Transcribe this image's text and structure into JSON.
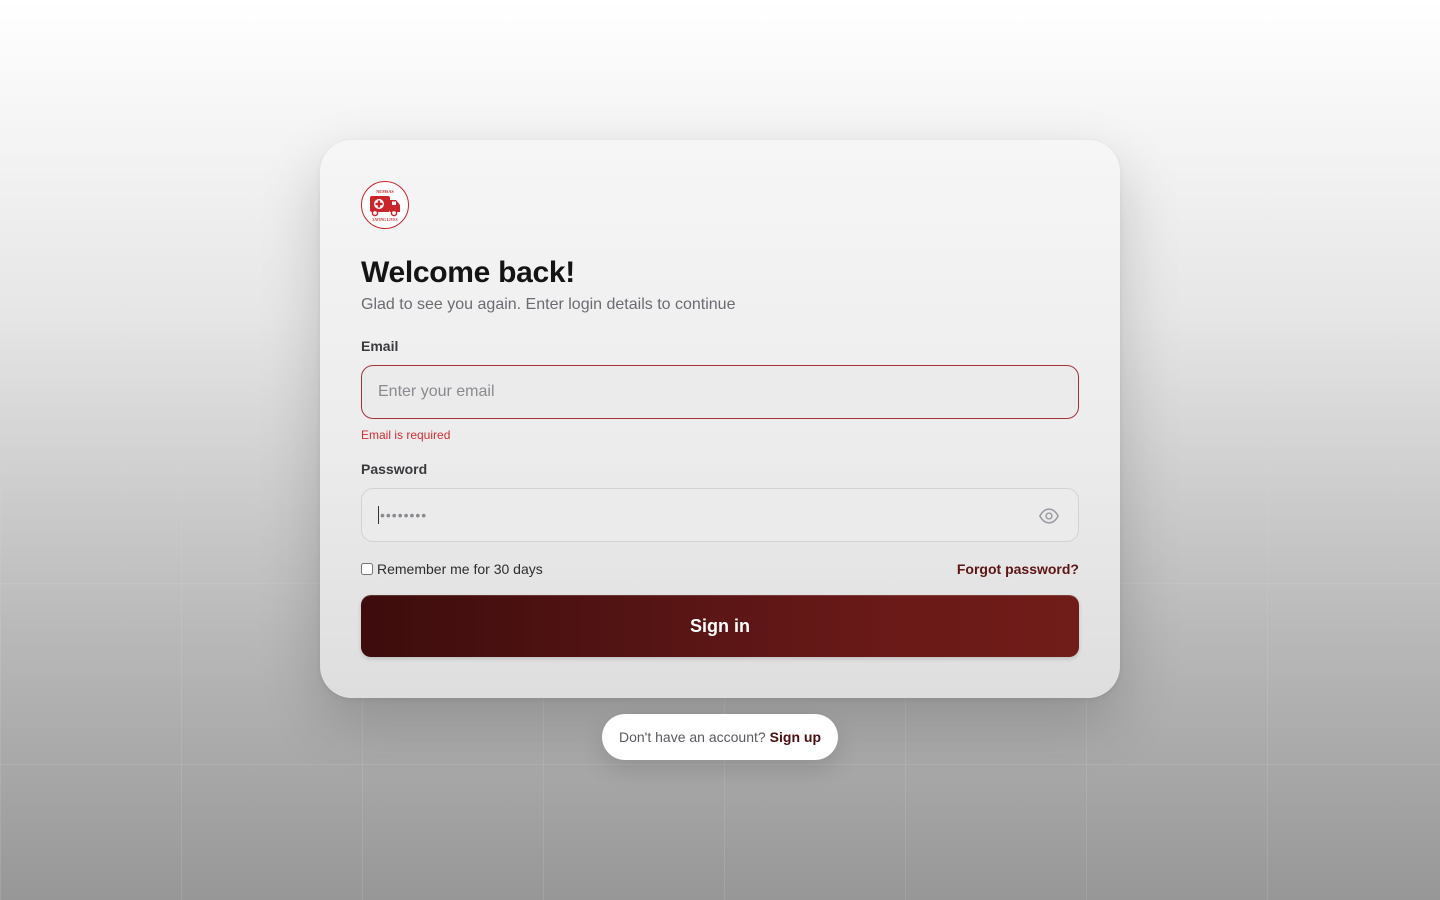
{
  "brand": {
    "logo_top_text": "NEMSAS",
    "logo_bottom_text": "SAVING LIVES",
    "accent_color": "#c8262b",
    "primary_color": "#5a1515"
  },
  "header": {
    "title": "Welcome back!",
    "subtitle": "Glad to see you again. Enter login details to continue"
  },
  "form": {
    "email": {
      "label": "Email",
      "placeholder": "Enter your email",
      "value": "",
      "error": "Email is required"
    },
    "password": {
      "label": "Password",
      "masked_value": "••••••••",
      "toggle_icon": "eye-icon"
    },
    "remember_label": "Remember me for 30 days",
    "forgot_label": "Forgot password?",
    "submit_label": "Sign in"
  },
  "footer": {
    "prompt": "Don't have an account?",
    "signup_label": "Sign up"
  }
}
